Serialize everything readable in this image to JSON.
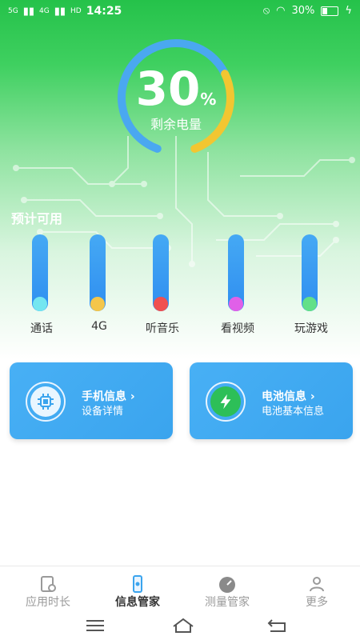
{
  "status_bar": {
    "signal1": "5G",
    "signal2": "4G",
    "hd": "HD",
    "time": "14:25",
    "battery_pct": "30%"
  },
  "battery": {
    "percent_value": "30",
    "percent_unit": "%",
    "label": "剩余电量",
    "fraction": 0.3,
    "ring_color": "#4aa8f0",
    "ring_accent_color": "#f2c631"
  },
  "estimate": {
    "title": "预计可用",
    "items": [
      {
        "label": "通话",
        "dot_color": "#74e6f0"
      },
      {
        "label": "4G",
        "dot_color": "#f4c64a"
      },
      {
        "label": "听音乐",
        "dot_color": "#f05050"
      },
      {
        "label": "看视频",
        "dot_color": "#e060e8"
      },
      {
        "label": "玩游戏",
        "dot_color": "#62e088"
      }
    ]
  },
  "cards": {
    "phone": {
      "title": "手机信息 ›",
      "subtitle": "设备详情",
      "icon": "chip-icon"
    },
    "battery": {
      "title": "电池信息 ›",
      "subtitle": "电池基本信息",
      "icon": "lightning-icon"
    }
  },
  "bottom_nav": {
    "items": [
      {
        "label": "应用时长",
        "icon": "app-usage-icon"
      },
      {
        "label": "信息管家",
        "icon": "phone-info-icon"
      },
      {
        "label": "测量管家",
        "icon": "gauge-icon"
      },
      {
        "label": "更多",
        "icon": "user-icon"
      }
    ],
    "active_index": 1
  }
}
